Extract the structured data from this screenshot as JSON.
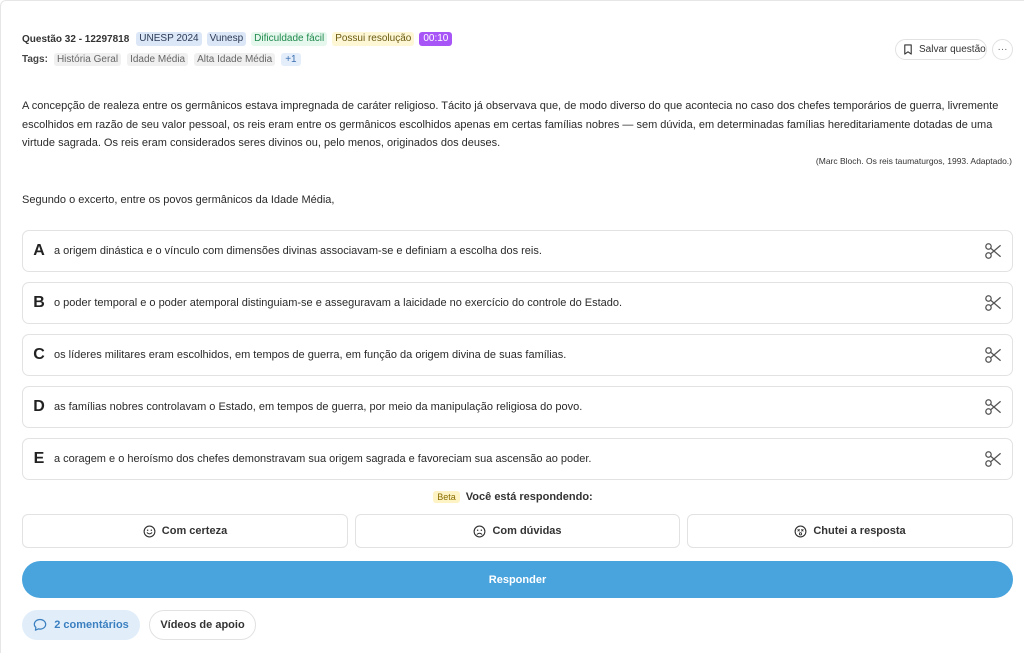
{
  "question": {
    "id_label": "Questão 32 - 12297818",
    "badges": {
      "exam": "UNESP 2024",
      "board": "Vunesp",
      "difficulty": "Dificuldade fácil",
      "resolution": "Possui resolução",
      "timer": "00:10"
    },
    "tags_label": "Tags:",
    "tags": [
      "História Geral",
      "Idade Média",
      "Alta Idade Média"
    ],
    "tags_more": "+1",
    "save_label": "Salvar questão",
    "more_label": "···",
    "text": "A concepção de realeza entre os germânicos estava impregnada de caráter religioso. Tácito já observava que, de modo diverso do que acontecia no caso dos chefes temporários de guerra, livremente escolhidos em razão de seu valor pessoal, os reis eram entre os germânicos escolhidos apenas em certas famílias nobres — sem dúvida, em determinadas famílias hereditariamente dotadas de uma virtude sagrada. Os reis eram considerados seres divinos ou, pelo menos, originados dos deuses.",
    "source": "(Marc Bloch. Os reis taumaturgos, 1993. Adaptado.)",
    "prompt": "Segundo o excerto, entre os povos germânicos da Idade Média,"
  },
  "alternatives": [
    {
      "letter": "A",
      "text": "a origem dinástica e o vínculo com dimensões divinas associavam-se e definiam a escolha dos reis."
    },
    {
      "letter": "B",
      "text": "o poder temporal e o poder atemporal distinguiam-se e asseguravam a laicidade no exercício do controle do Estado."
    },
    {
      "letter": "C",
      "text": "os líderes militares eram escolhidos, em tempos de guerra, em função da origem divina de suas famílias."
    },
    {
      "letter": "D",
      "text": "as famílias nobres controlavam o Estado, em tempos de guerra, por meio da manipulação religiosa do povo."
    },
    {
      "letter": "E",
      "text": "a coragem e o heroísmo dos chefes demonstravam sua origem sagrada e favoreciam sua ascensão ao poder."
    }
  ],
  "confidence": {
    "beta": "Beta",
    "label": "Você está respondendo:",
    "options": [
      "Com certeza",
      "Com dúvidas",
      "Chutei a resposta"
    ]
  },
  "submit_label": "Responder",
  "footer": {
    "comments": "2 comentários",
    "videos": "Vídeos de apoio"
  },
  "colors": {
    "primary": "#49a4dd",
    "timer": "#a855f7"
  }
}
